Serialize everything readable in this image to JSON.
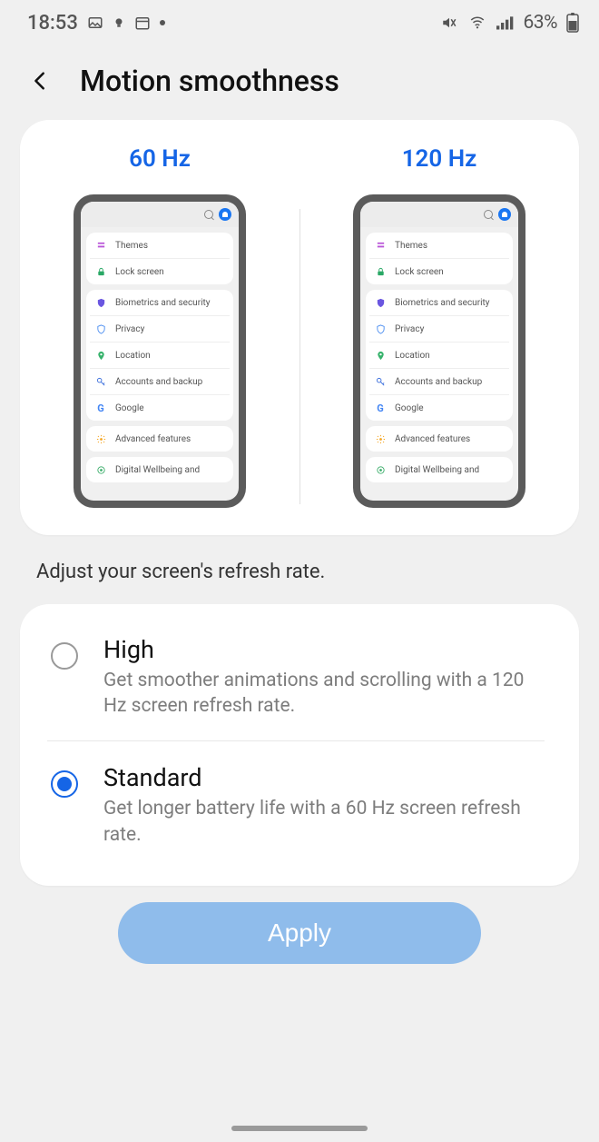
{
  "status": {
    "time": "18:53",
    "battery": "63%"
  },
  "header": {
    "title": "Motion smoothness"
  },
  "preview": {
    "left_hz": "60 Hz",
    "right_hz": "120 Hz",
    "settings": {
      "group1": [
        {
          "icon": "themes",
          "color": "#b955d8",
          "label": "Themes"
        },
        {
          "icon": "lock",
          "color": "#2aa866",
          "label": "Lock screen"
        }
      ],
      "group2": [
        {
          "icon": "shield",
          "color": "#6a56e0",
          "label": "Biometrics and security"
        },
        {
          "icon": "privacy",
          "color": "#4c8ef0",
          "label": "Privacy"
        },
        {
          "icon": "location",
          "color": "#36b26b",
          "label": "Location"
        },
        {
          "icon": "key",
          "color": "#3a6edc",
          "label": "Accounts and backup"
        },
        {
          "icon": "google",
          "color": "#4285f4",
          "label": "Google"
        }
      ],
      "group3": [
        {
          "icon": "gear",
          "color": "#f5a623",
          "label": "Advanced features"
        }
      ],
      "group4": [
        {
          "icon": "wellbeing",
          "color": "#3cae6c",
          "label": "Digital Wellbeing and"
        }
      ]
    }
  },
  "description": "Adjust your screen's refresh rate.",
  "options": [
    {
      "id": "high",
      "title": "High",
      "desc": "Get smoother animations and scrolling with a 120 Hz screen refresh rate.",
      "checked": false
    },
    {
      "id": "standard",
      "title": "Standard",
      "desc": "Get longer battery life with a 60 Hz screen refresh rate.",
      "checked": true
    }
  ],
  "apply_label": "Apply"
}
